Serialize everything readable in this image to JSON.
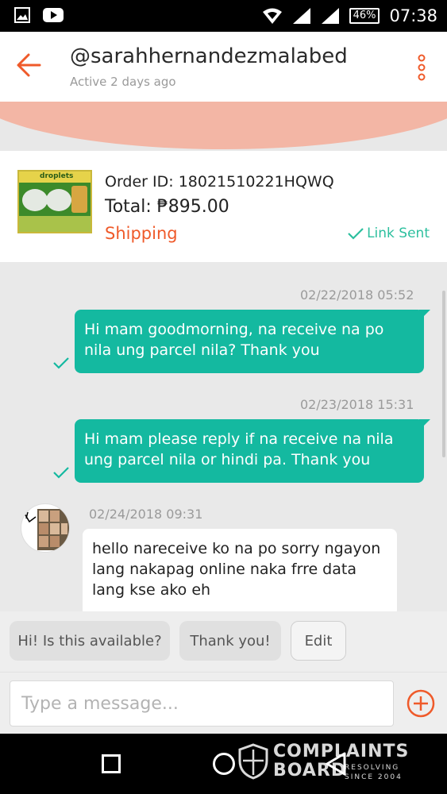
{
  "status_bar": {
    "time": "07:38",
    "battery": "46%",
    "icons": [
      "image-icon",
      "youtube-icon",
      "wifi-icon",
      "signal-icon",
      "signal-icon",
      "battery-icon"
    ]
  },
  "header": {
    "username": "@sarahhernandezmalabed",
    "active_status": "Active 2 days ago"
  },
  "order": {
    "id_text": "Order ID: 18021510221HQWQ",
    "total_text": "Total: ₱895.00",
    "status": "Shipping",
    "link_status": "Link Sent",
    "product_brand": "droplets"
  },
  "messages": [
    {
      "direction": "out",
      "timestamp": "02/22/2018 05:52",
      "lines": [
        "Hi mam goodmorning,  na receive na po",
        "nila ung parcel nila?  Thank you"
      ]
    },
    {
      "direction": "out",
      "timestamp": "02/23/2018 15:31",
      "lines": [
        "Hi mam please reply if na receive na nila",
        "ung parcel nila or hindi pa.  Thank you"
      ]
    },
    {
      "direction": "in",
      "timestamp": "02/24/2018 09:31",
      "lines": [
        "hello nareceive ko na po sorry ngayon",
        "lang nakapag online naka frre data",
        "lang kse ako eh"
      ]
    }
  ],
  "quick_replies": [
    "Hi! Is this available?",
    "Thank you!",
    "Edit"
  ],
  "composer": {
    "placeholder": "Type a message..."
  },
  "watermark": {
    "line1": "COMPLAINTS",
    "line2": "BOARD",
    "tag1": "RESOLVING",
    "tag2": "SINCE 2004"
  },
  "colors": {
    "accent_orange": "#ef5a2a",
    "bubble_teal": "#14b9a0",
    "link_sent_teal": "#2cbf9e"
  }
}
